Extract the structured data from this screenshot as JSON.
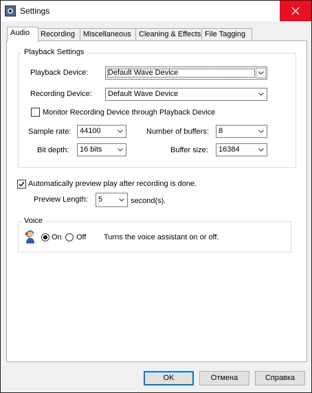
{
  "window": {
    "title": "Settings"
  },
  "tabs": [
    "Audio",
    "Recording",
    "Miscellaneous",
    "Cleaning & Effects",
    "File Tagging"
  ],
  "playback_settings": {
    "legend": "Playback Settings",
    "playback_device_label": "Playback Device:",
    "playback_device_value": "Default Wave Device",
    "recording_device_label": "Recording Device:",
    "recording_device_value": "Default Wave Device",
    "monitor_label": "Monitor Recording Device through Playback Device",
    "monitor_checked": false,
    "sample_rate_label": "Sample rate:",
    "sample_rate_value": "44100",
    "bit_depth_label": "Bit depth:",
    "bit_depth_value": "16 bits",
    "num_buffers_label": "Number of buffers:",
    "num_buffers_value": "8",
    "buffer_size_label": "Buffer size:",
    "buffer_size_value": "16384"
  },
  "preview": {
    "auto_preview_label": "Automatically preview play after recording is done.",
    "auto_preview_checked": true,
    "length_label": "Preview Length:",
    "length_value": "5",
    "unit": "second(s)."
  },
  "voice": {
    "legend": "Voice",
    "on_label": "On",
    "off_label": "Off",
    "selected": "On",
    "description": "Turns the voice assistant on or off."
  },
  "buttons": {
    "ok": "OK",
    "cancel": "Отмена",
    "help": "Справка"
  },
  "colors": {
    "close": "#e81123",
    "focus": "#0078d7"
  }
}
